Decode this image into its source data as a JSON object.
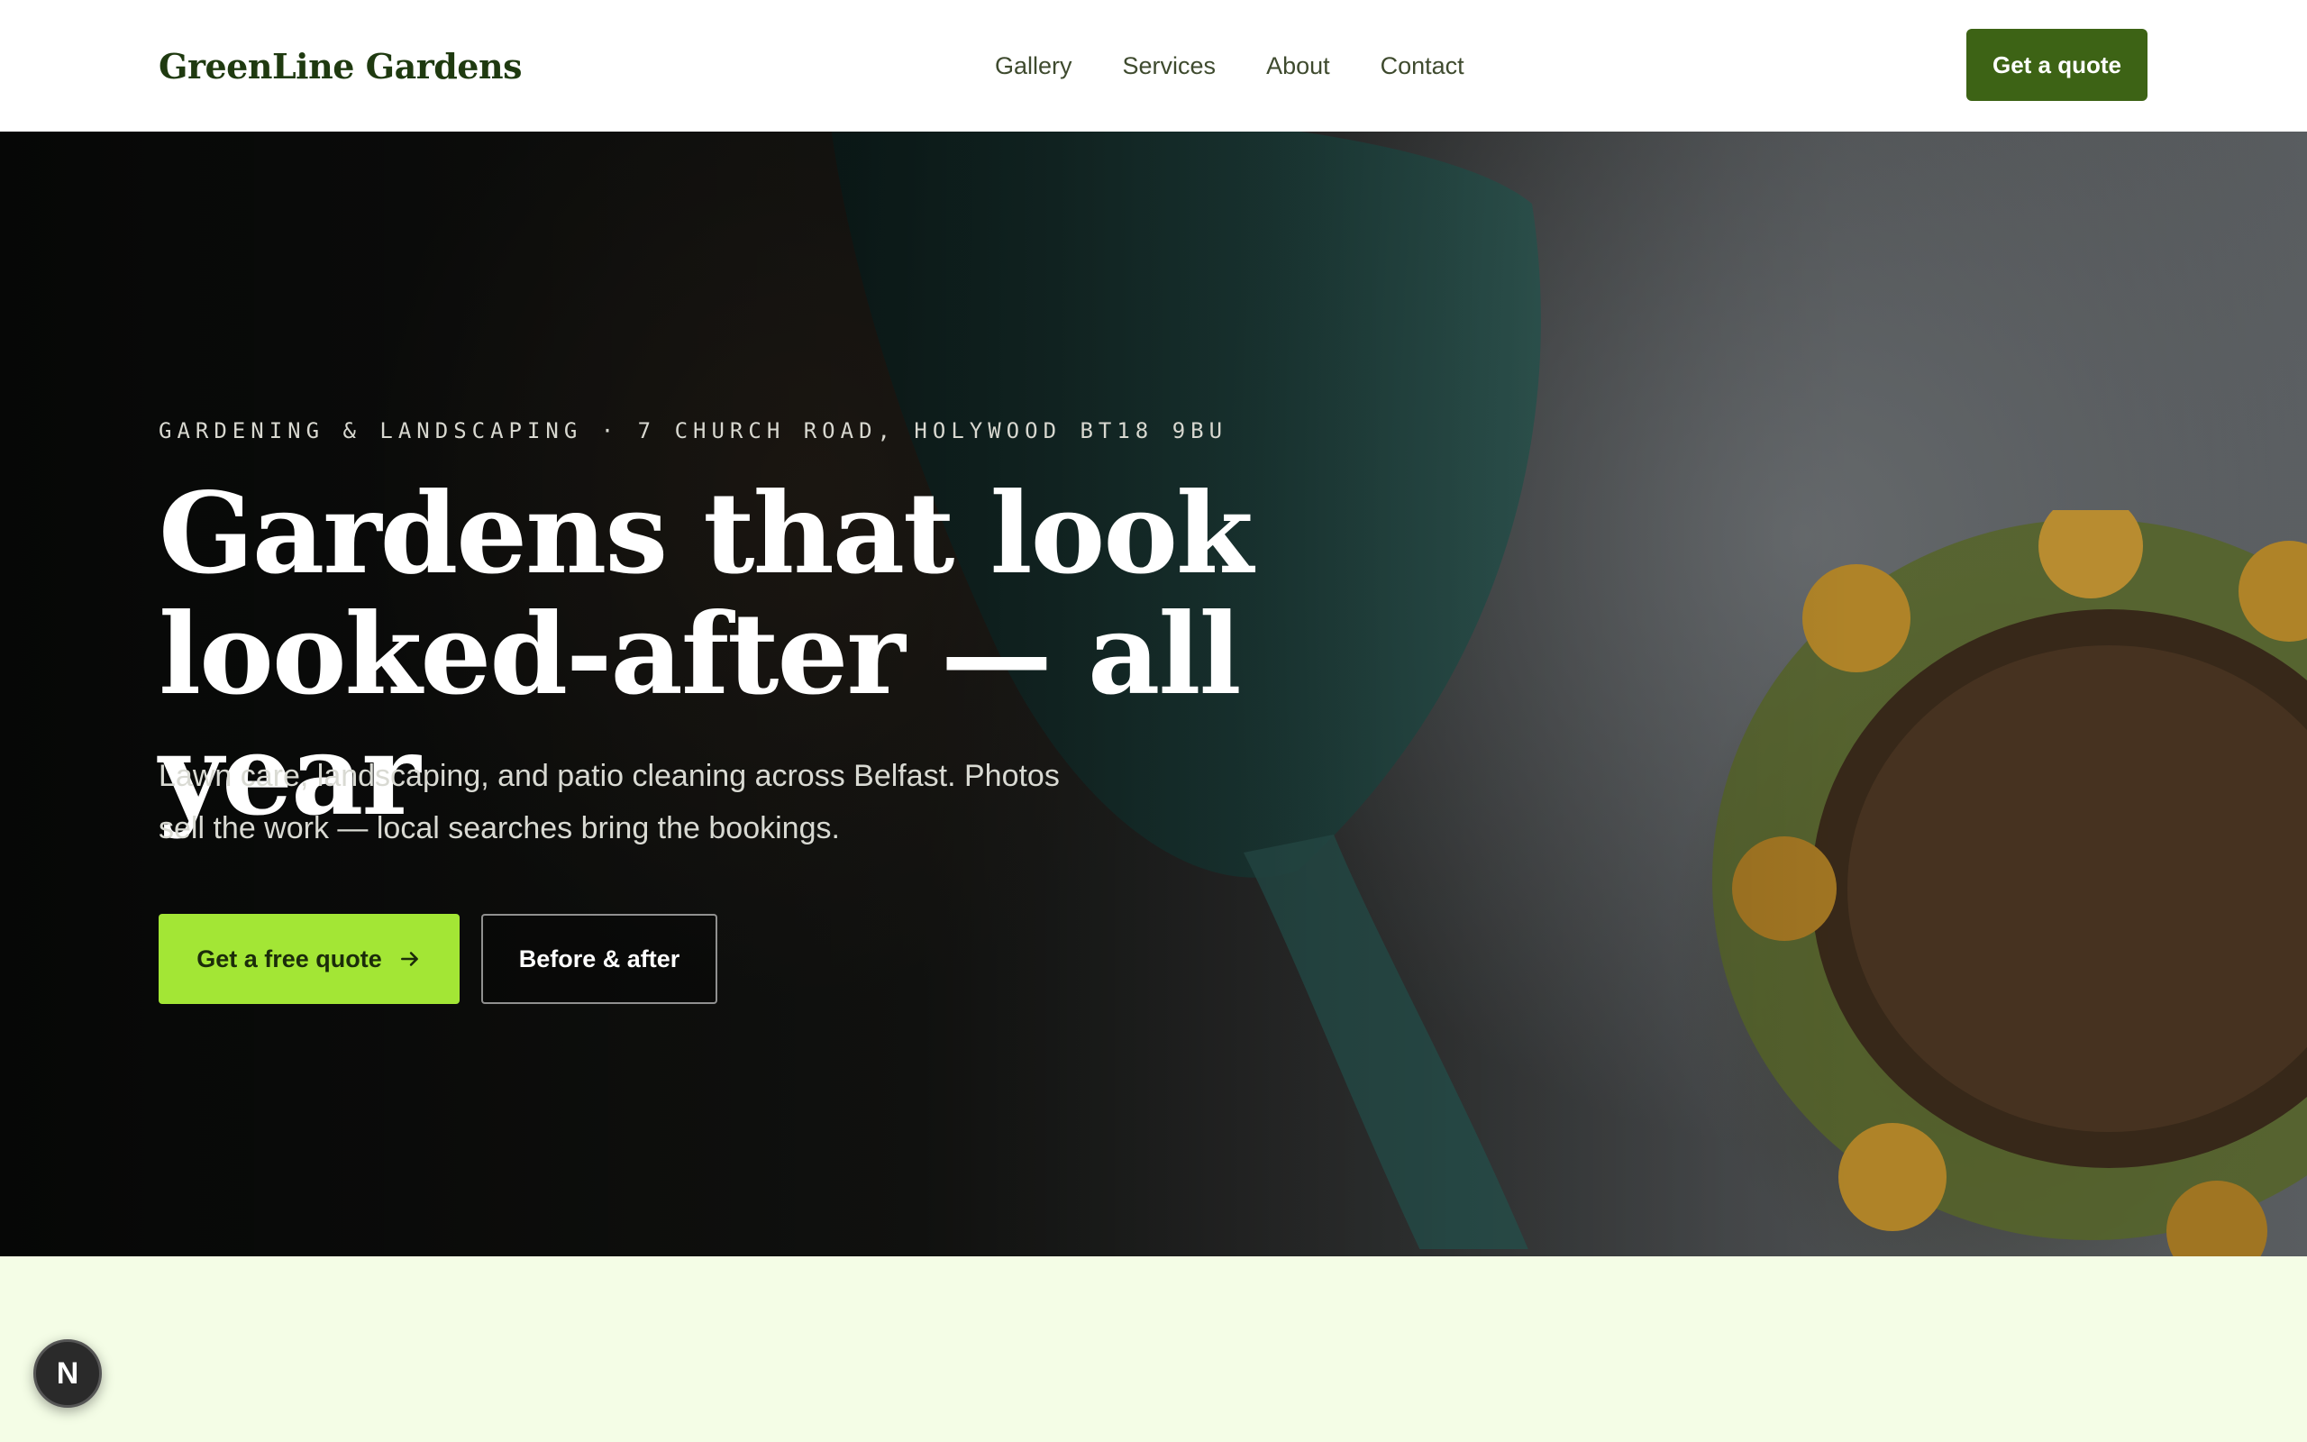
{
  "header": {
    "brand": "GreenLine Gardens",
    "nav": [
      "Gallery",
      "Services",
      "About",
      "Contact"
    ],
    "cta_label": "Get a quote"
  },
  "hero": {
    "eyebrow": "GARDENING & LANDSCAPING · 7 CHURCH ROAD, HOLYWOOD BT18 9BU",
    "headline_line1": "Gardens that look",
    "headline_line2": "looked-after — all year",
    "subtext": "Lawn care, landscaping, and patio cleaning across Belfast. Photos sell the work — local searches bring the bookings.",
    "primary_cta": "Get a free quote",
    "secondary_cta": "Before & after"
  },
  "fab": {
    "label": "N"
  },
  "colors": {
    "brand_green": "#3d6315",
    "accent_lime": "#a3e635",
    "section_bg": "#f4fde6"
  },
  "icons": {
    "primary_cta_icon": "arrow-right-icon"
  }
}
